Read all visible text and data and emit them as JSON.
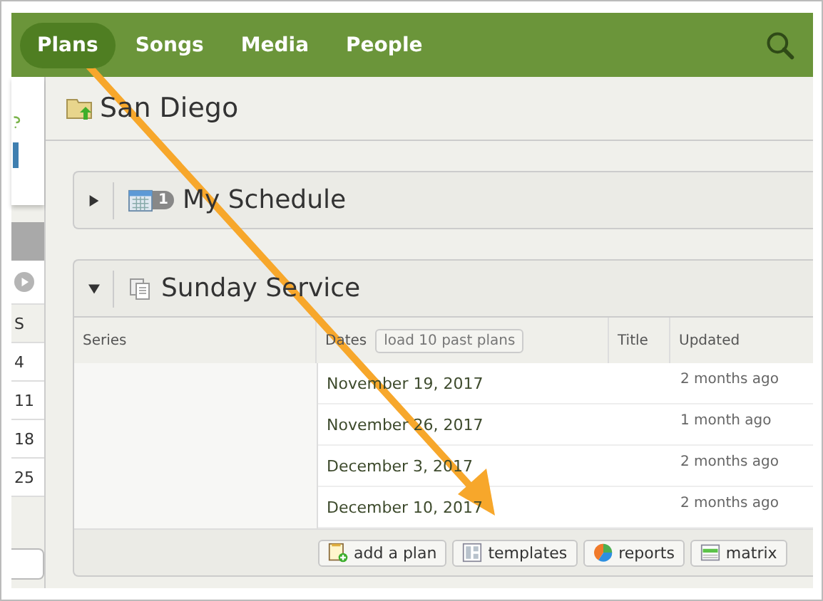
{
  "nav": {
    "tabs": [
      {
        "label": "Plans",
        "selected": true
      },
      {
        "label": "Songs",
        "selected": false
      },
      {
        "label": "Media",
        "selected": false
      },
      {
        "label": "People",
        "selected": false
      }
    ]
  },
  "mini_calendar": {
    "day_header": "S",
    "days": [
      "4",
      "11",
      "18",
      "25"
    ]
  },
  "folder": {
    "title": "San Diego"
  },
  "panels": [
    {
      "title": "My Schedule",
      "expanded": false,
      "kind": "schedule",
      "badge": "1"
    },
    {
      "title": "Sunday Service",
      "expanded": true,
      "kind": "service",
      "table": {
        "columns": [
          "Series",
          "Dates",
          "Title",
          "Updated"
        ],
        "load_button": "load 10 past plans",
        "rows": [
          {
            "date": "November 19, 2017",
            "updated": "2 months ago"
          },
          {
            "date": "November 26, 2017",
            "updated": "1 month ago"
          },
          {
            "date": "December 3, 2017",
            "updated": "2 months ago"
          },
          {
            "date": "December 10, 2017",
            "updated": "2 months ago"
          }
        ]
      },
      "buttons": [
        {
          "label": "add a plan",
          "kind": "add"
        },
        {
          "label": "templates",
          "kind": "templates"
        },
        {
          "label": "reports",
          "kind": "reports"
        },
        {
          "label": "matrix",
          "kind": "matrix"
        }
      ]
    }
  ]
}
